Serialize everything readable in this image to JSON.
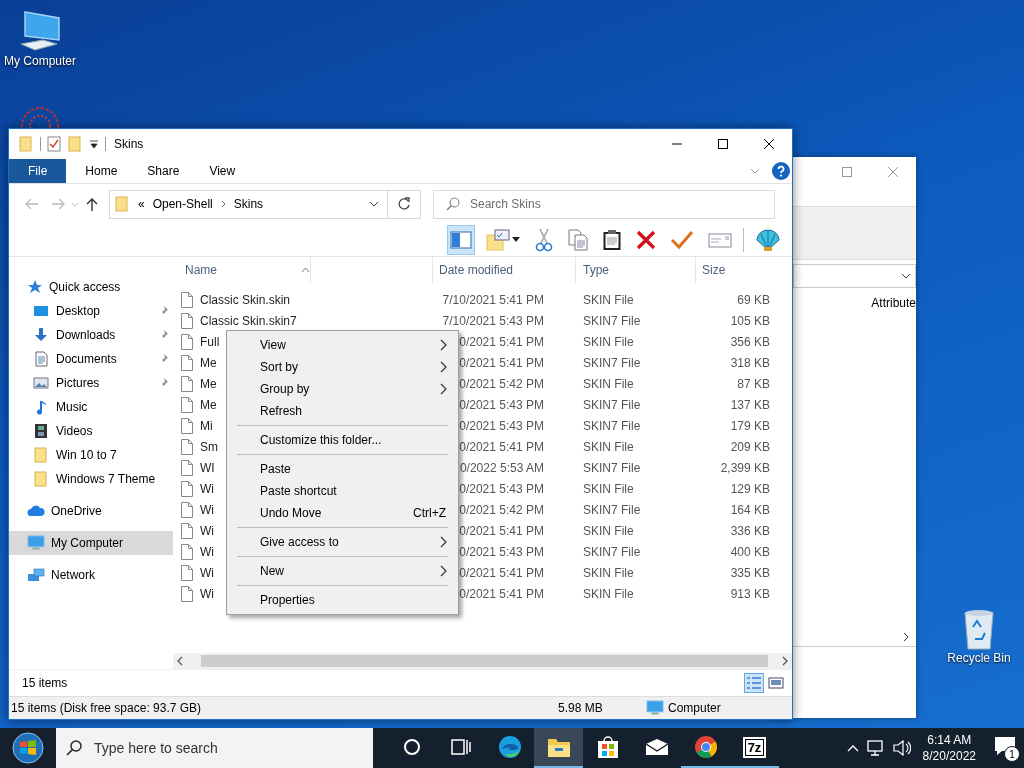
{
  "desktop_icons": [
    {
      "kind": "computer",
      "label": "My Computer"
    },
    {
      "kind": "recycle",
      "label": "Recycle Bin"
    }
  ],
  "back_window": {
    "column_1": "Attribute"
  },
  "window": {
    "title": "Skins",
    "ribbon_tabs": [
      {
        "kind": "file",
        "label": "File"
      },
      {
        "kind": "tab",
        "label": "Home"
      },
      {
        "kind": "tab",
        "label": "Share"
      },
      {
        "kind": "tab",
        "label": "View"
      }
    ],
    "address": {
      "overflow": "«",
      "path": [
        "Open-Shell",
        "Skins"
      ]
    },
    "search": {
      "placeholder": "Search Skins"
    },
    "toolbar": [
      {
        "kind": "pane",
        "selected": true
      },
      {
        "kind": "folder-options",
        "selected": false
      },
      {
        "kind": "cut",
        "selected": false
      },
      {
        "kind": "copy",
        "selected": false
      },
      {
        "kind": "paste",
        "selected": false
      },
      {
        "kind": "delete",
        "selected": false
      },
      {
        "kind": "properties",
        "selected": false
      },
      {
        "kind": "mail",
        "selected": false
      },
      {
        "kind": "shell",
        "selected": false
      }
    ],
    "nav_pane": [
      {
        "kind": "star",
        "label": "Quick access",
        "selected": false,
        "children": [
          {
            "kind": "desktop",
            "label": "Desktop",
            "pinned": true,
            "selected": false
          },
          {
            "kind": "downloads",
            "label": "Downloads",
            "pinned": true,
            "selected": false
          },
          {
            "kind": "documents",
            "label": "Documents",
            "pinned": true,
            "selected": false
          },
          {
            "kind": "pictures",
            "label": "Pictures",
            "pinned": true,
            "selected": false
          },
          {
            "kind": "music",
            "label": "Music",
            "pinned": false,
            "selected": false
          },
          {
            "kind": "videos",
            "label": "Videos",
            "pinned": false,
            "selected": false
          },
          {
            "kind": "folder",
            "label": "Win 10 to 7",
            "pinned": false,
            "selected": false
          },
          {
            "kind": "folder",
            "label": "Windows 7 Theme",
            "pinned": false,
            "selected": false
          }
        ]
      },
      {
        "kind": "cloud",
        "label": "OneDrive",
        "selected": false
      },
      {
        "kind": "computer",
        "label": "My Computer",
        "selected": true
      },
      {
        "kind": "network",
        "label": "Network",
        "selected": false
      }
    ],
    "file_list": {
      "columns": [
        {
          "label": "Name",
          "sorted": true
        },
        {
          "label": "Date modified",
          "sorted": false
        },
        {
          "label": "Type",
          "sorted": false
        },
        {
          "label": "Size",
          "sorted": false
        }
      ],
      "rows": [
        {
          "name": "Classic Skin.skin",
          "date": "7/10/2021 5:41 PM",
          "type": "SKIN File",
          "size": "69 KB"
        },
        {
          "name": "Classic Skin.skin7",
          "date": "7/10/2021 5:43 PM",
          "type": "SKIN7 File",
          "size": "105 KB"
        },
        {
          "name": "Full",
          "date": "0/2021 5:41 PM",
          "type": "SKIN File",
          "size": "356 KB"
        },
        {
          "name": "Me",
          "date": "0/2021 5:41 PM",
          "type": "SKIN7 File",
          "size": "318 KB"
        },
        {
          "name": "Me",
          "date": "0/2021 5:42 PM",
          "type": "SKIN File",
          "size": "87 KB"
        },
        {
          "name": "Me",
          "date": "0/2021 5:43 PM",
          "type": "SKIN7 File",
          "size": "137 KB"
        },
        {
          "name": "Mi",
          "date": "0/2021 5:43 PM",
          "type": "SKIN7 File",
          "size": "179 KB"
        },
        {
          "name": "Sm",
          "date": "0/2021 5:41 PM",
          "type": "SKIN File",
          "size": "209 KB"
        },
        {
          "name": "WI",
          "date": "0/2022 5:53 AM",
          "type": "SKIN7 File",
          "size": "2,399 KB"
        },
        {
          "name": "Wi",
          "date": "0/2021 5:43 PM",
          "type": "SKIN File",
          "size": "129 KB"
        },
        {
          "name": "Wi",
          "date": "0/2021 5:42 PM",
          "type": "SKIN7 File",
          "size": "164 KB"
        },
        {
          "name": "Wi",
          "date": "0/2021 5:41 PM",
          "type": "SKIN File",
          "size": "336 KB"
        },
        {
          "name": "Wi",
          "date": "0/2021 5:43 PM",
          "type": "SKIN7 File",
          "size": "400 KB"
        },
        {
          "name": "Wi",
          "date": "0/2021 5:41 PM",
          "type": "SKIN File",
          "size": "335 KB"
        },
        {
          "name": "Wi",
          "date": "0/2021 5:41 PM",
          "type": "SKIN File",
          "size": "913 KB"
        }
      ]
    },
    "item_count": "15 items",
    "view_buttons": [
      {
        "kind": "details",
        "selected": true
      },
      {
        "kind": "large-icons",
        "selected": false
      }
    ],
    "status_bar": {
      "summary": "15 items (Disk free space: 93.7 GB)",
      "size": "5.98 MB",
      "location": "Computer"
    }
  },
  "context_menu": [
    {
      "kind": "item",
      "label": "View",
      "submenu": true
    },
    {
      "kind": "item",
      "label": "Sort by",
      "submenu": true
    },
    {
      "kind": "item",
      "label": "Group by",
      "submenu": true
    },
    {
      "kind": "item",
      "label": "Refresh",
      "submenu": false
    },
    {
      "kind": "separator"
    },
    {
      "kind": "item",
      "label": "Customize this folder...",
      "submenu": false
    },
    {
      "kind": "separator"
    },
    {
      "kind": "item",
      "label": "Paste",
      "submenu": false
    },
    {
      "kind": "item",
      "label": "Paste shortcut",
      "submenu": false
    },
    {
      "kind": "item",
      "label": "Undo Move",
      "shortcut": "Ctrl+Z",
      "submenu": false
    },
    {
      "kind": "separator"
    },
    {
      "kind": "item",
      "label": "Give access to",
      "submenu": true
    },
    {
      "kind": "separator"
    },
    {
      "kind": "item",
      "label": "New",
      "submenu": true
    },
    {
      "kind": "separator"
    },
    {
      "kind": "item",
      "label": "Properties",
      "submenu": false
    }
  ],
  "taskbar": {
    "search_placeholder": "Type here to search",
    "apps": [
      {
        "kind": "cortana",
        "running": false,
        "active": false
      },
      {
        "kind": "taskview",
        "running": false,
        "active": false
      },
      {
        "kind": "edge",
        "running": false,
        "active": false
      },
      {
        "kind": "explorer",
        "running": true,
        "active": true
      },
      {
        "kind": "store",
        "running": false,
        "active": false
      },
      {
        "kind": "mail",
        "running": false,
        "active": false
      },
      {
        "kind": "chrome",
        "running": true,
        "active": false
      },
      {
        "kind": "archiver",
        "label": "7z",
        "running": true,
        "active": false
      }
    ],
    "clock": {
      "time": "6:14 AM",
      "date": "8/20/2022"
    },
    "notifications": "1"
  }
}
